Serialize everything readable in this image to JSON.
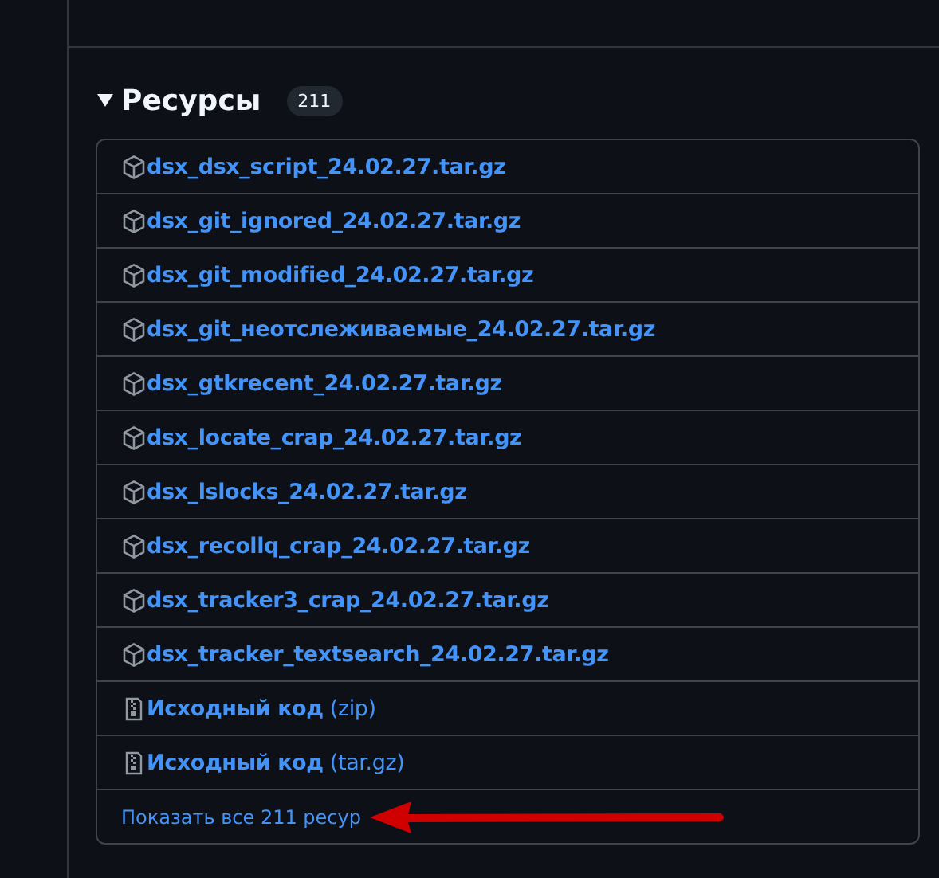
{
  "assets": {
    "title": "Ресурсы",
    "count": "211",
    "expanded": true,
    "items": [
      {
        "kind": "package",
        "name": "dsx_dsx_script_24.02.27.tar.gz"
      },
      {
        "kind": "package",
        "name": "dsx_git_ignored_24.02.27.tar.gz"
      },
      {
        "kind": "package",
        "name": "dsx_git_modified_24.02.27.tar.gz"
      },
      {
        "kind": "package",
        "name": "dsx_git_неотслеживаемые_24.02.27.tar.gz"
      },
      {
        "kind": "package",
        "name": "dsx_gtkrecent_24.02.27.tar.gz"
      },
      {
        "kind": "package",
        "name": "dsx_locate_crap_24.02.27.tar.gz"
      },
      {
        "kind": "package",
        "name": "dsx_lslocks_24.02.27.tar.gz"
      },
      {
        "kind": "package",
        "name": "dsx_recollq_crap_24.02.27.tar.gz"
      },
      {
        "kind": "package",
        "name": "dsx_tracker3_crap_24.02.27.tar.gz"
      },
      {
        "kind": "package",
        "name": "dsx_tracker_textsearch_24.02.27.tar.gz"
      },
      {
        "kind": "source",
        "name": "Исходный код",
        "format": "(zip)"
      },
      {
        "kind": "source",
        "name": "Исходный код",
        "format": "(tar.gz)"
      }
    ],
    "show_all": "Показать все 211 ресур"
  }
}
